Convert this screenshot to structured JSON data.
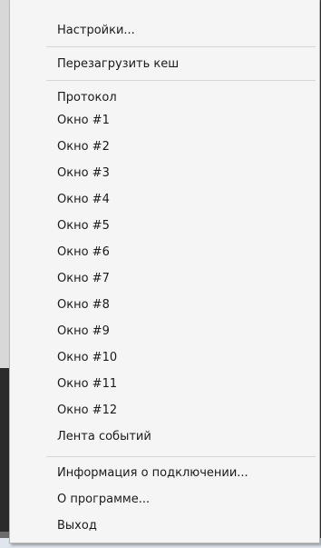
{
  "menu": {
    "group1": [
      "Настройки..."
    ],
    "group2": [
      "Перезагрузить кеш"
    ],
    "group3": [
      "Протокол",
      "Окно #1",
      "Окно #2",
      "Окно #3",
      "Окно #4",
      "Окно #5",
      "Окно #6",
      "Окно #7",
      "Окно #8",
      "Окно #9",
      "Окно #10",
      "Окно #11",
      "Окно #12",
      "Лента событий"
    ],
    "group4": [
      "Информация о подключении...",
      "О программе...",
      "Выход"
    ]
  }
}
